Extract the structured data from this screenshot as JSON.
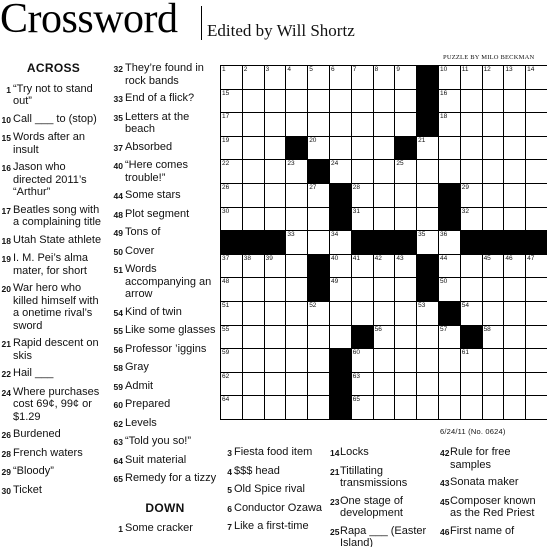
{
  "header": {
    "title": "Crossword",
    "editor": "Edited by Will Shortz",
    "byline": "PUZZLE BY MILO BECKMAN",
    "dateline": "6/24/11 (No. 0624)"
  },
  "across_heading": "ACROSS",
  "down_heading": "DOWN",
  "across_col1": [
    {
      "n": "1",
      "t": "“Try not to stand out”"
    },
    {
      "n": "10",
      "t": "Call ___ to (stop)"
    },
    {
      "n": "15",
      "t": "Words after an insult"
    },
    {
      "n": "16",
      "t": "Jason who directed 2011’s “Arthur”"
    },
    {
      "n": "17",
      "t": "Beatles song with a complaining title"
    },
    {
      "n": "18",
      "t": "Utah State athlete"
    },
    {
      "n": "19",
      "t": "I. M. Pei’s alma mater, for short"
    },
    {
      "n": "20",
      "t": "War hero who killed himself with a onetime rival’s sword"
    },
    {
      "n": "21",
      "t": "Rapid descent on skis"
    },
    {
      "n": "22",
      "t": "Hail ___"
    },
    {
      "n": "24",
      "t": "Where purchases cost 69¢, 99¢ or $1.29"
    },
    {
      "n": "26",
      "t": "Burdened"
    },
    {
      "n": "28",
      "t": "French waters"
    },
    {
      "n": "29",
      "t": "“Bloody”"
    },
    {
      "n": "30",
      "t": "Ticket"
    }
  ],
  "across_col2": [
    {
      "n": "32",
      "t": "They’re found in rock bands"
    },
    {
      "n": "33",
      "t": "End of a flick?"
    },
    {
      "n": "35",
      "t": "Letters at the beach"
    },
    {
      "n": "37",
      "t": "Absorbed"
    },
    {
      "n": "40",
      "t": "“Here comes trouble!”"
    },
    {
      "n": "44",
      "t": "Some stars"
    },
    {
      "n": "48",
      "t": "Plot segment"
    },
    {
      "n": "49",
      "t": "Tons of"
    },
    {
      "n": "50",
      "t": "Cover"
    },
    {
      "n": "51",
      "t": "Words accompanying an arrow"
    },
    {
      "n": "54",
      "t": "Kind of twin"
    },
    {
      "n": "55",
      "t": "Like some glasses"
    },
    {
      "n": "56",
      "t": "Professor ’iggins"
    },
    {
      "n": "58",
      "t": "Gray"
    },
    {
      "n": "59",
      "t": "Admit"
    },
    {
      "n": "60",
      "t": "Prepared"
    },
    {
      "n": "62",
      "t": "Levels"
    },
    {
      "n": "63",
      "t": "“Told you so!”"
    },
    {
      "n": "64",
      "t": "Suit material"
    },
    {
      "n": "65",
      "t": "Remedy for a tizzy"
    }
  ],
  "down_first_partial": {
    "n": "1",
    "t": "Some cracker"
  },
  "down_col1": [
    {
      "n": "3",
      "t": "Fiesta food item"
    },
    {
      "n": "4",
      "t": "$$$ head"
    },
    {
      "n": "5",
      "t": "Old Spice rival"
    },
    {
      "n": "6",
      "t": "Conductor Ozawa"
    },
    {
      "n": "7",
      "t": "Like a first-time"
    }
  ],
  "down_col2": [
    {
      "n": "14",
      "t": "Locks"
    },
    {
      "n": "21",
      "t": "Titillating transmissions"
    },
    {
      "n": "23",
      "t": "One stage of development"
    },
    {
      "n": "25",
      "t": "Rapa ___ (Easter Island)"
    }
  ],
  "down_col3": [
    {
      "n": "42",
      "t": "Rule for free samples"
    },
    {
      "n": "43",
      "t": "Sonata maker"
    },
    {
      "n": "45",
      "t": "Composer known as the Red Priest"
    },
    {
      "n": "46",
      "t": "First name of"
    }
  ],
  "grid_numbers": [
    [
      [
        0,
        0,
        "1"
      ],
      [
        0,
        1,
        "2"
      ],
      [
        0,
        2,
        "3"
      ],
      [
        0,
        3,
        "4"
      ],
      [
        0,
        4,
        "5"
      ],
      [
        0,
        5,
        "6"
      ],
      [
        0,
        6,
        "7"
      ],
      [
        0,
        7,
        "8"
      ],
      [
        0,
        8,
        "9"
      ],
      [
        0,
        10,
        "10"
      ],
      [
        0,
        11,
        "11"
      ],
      [
        0,
        12,
        "12"
      ],
      [
        0,
        13,
        "13"
      ],
      [
        0,
        14,
        "14"
      ]
    ],
    [
      [
        1,
        0,
        "15"
      ],
      [
        1,
        10,
        "16"
      ],
      [
        2,
        0,
        "17"
      ],
      [
        2,
        10,
        "18"
      ],
      [
        3,
        0,
        "19"
      ],
      [
        3,
        4,
        "20"
      ],
      [
        3,
        9,
        "21"
      ],
      [
        4,
        0,
        "22"
      ],
      [
        4,
        3,
        "23"
      ],
      [
        4,
        5,
        "24"
      ],
      [
        4,
        8,
        "25"
      ],
      [
        5,
        0,
        "26"
      ],
      [
        5,
        4,
        "27"
      ],
      [
        5,
        6,
        "28"
      ],
      [
        5,
        11,
        "29"
      ],
      [
        6,
        0,
        "30"
      ],
      [
        6,
        6,
        "31"
      ],
      [
        6,
        11,
        "32"
      ],
      [
        7,
        3,
        "33"
      ],
      [
        7,
        5,
        "34"
      ],
      [
        7,
        9,
        "35"
      ],
      [
        7,
        10,
        "36"
      ],
      [
        8,
        0,
        "37"
      ],
      [
        8,
        1,
        "38"
      ],
      [
        8,
        2,
        "39"
      ],
      [
        8,
        5,
        "40"
      ],
      [
        8,
        6,
        "41"
      ],
      [
        8,
        7,
        "42"
      ],
      [
        8,
        8,
        "43"
      ],
      [
        8,
        10,
        "44"
      ],
      [
        8,
        12,
        "45"
      ],
      [
        8,
        13,
        "46"
      ],
      [
        8,
        14,
        "47"
      ],
      [
        9,
        0,
        "48"
      ],
      [
        9,
        5,
        "49"
      ],
      [
        9,
        10,
        "50"
      ],
      [
        10,
        0,
        "51"
      ],
      [
        10,
        4,
        "52"
      ],
      [
        10,
        9,
        "53"
      ],
      [
        10,
        11,
        "54"
      ],
      [
        11,
        0,
        "55"
      ],
      [
        11,
        7,
        "56"
      ],
      [
        11,
        10,
        "57"
      ],
      [
        11,
        12,
        "58"
      ],
      [
        12,
        0,
        "59"
      ],
      [
        12,
        6,
        "60"
      ],
      [
        12,
        11,
        "61"
      ],
      [
        13,
        0,
        "62"
      ],
      [
        13,
        6,
        "63"
      ],
      [
        14,
        0,
        "64"
      ],
      [
        14,
        6,
        "65"
      ]
    ]
  ],
  "black_cells": [
    [
      0,
      9
    ],
    [
      1,
      9
    ],
    [
      2,
      9
    ],
    [
      3,
      3
    ],
    [
      3,
      8
    ],
    [
      4,
      4
    ],
    [
      5,
      5
    ],
    [
      5,
      10
    ],
    [
      6,
      5
    ],
    [
      6,
      10
    ],
    [
      7,
      0
    ],
    [
      7,
      1
    ],
    [
      7,
      2
    ],
    [
      7,
      6
    ],
    [
      7,
      7
    ],
    [
      7,
      8
    ],
    [
      7,
      11
    ],
    [
      7,
      12
    ],
    [
      7,
      13
    ],
    [
      7,
      14
    ],
    [
      8,
      4
    ],
    [
      8,
      9
    ],
    [
      9,
      4
    ],
    [
      9,
      9
    ],
    [
      10,
      10
    ],
    [
      11,
      6
    ],
    [
      11,
      11
    ],
    [
      12,
      5
    ],
    [
      13,
      5
    ],
    [
      14,
      5
    ]
  ]
}
